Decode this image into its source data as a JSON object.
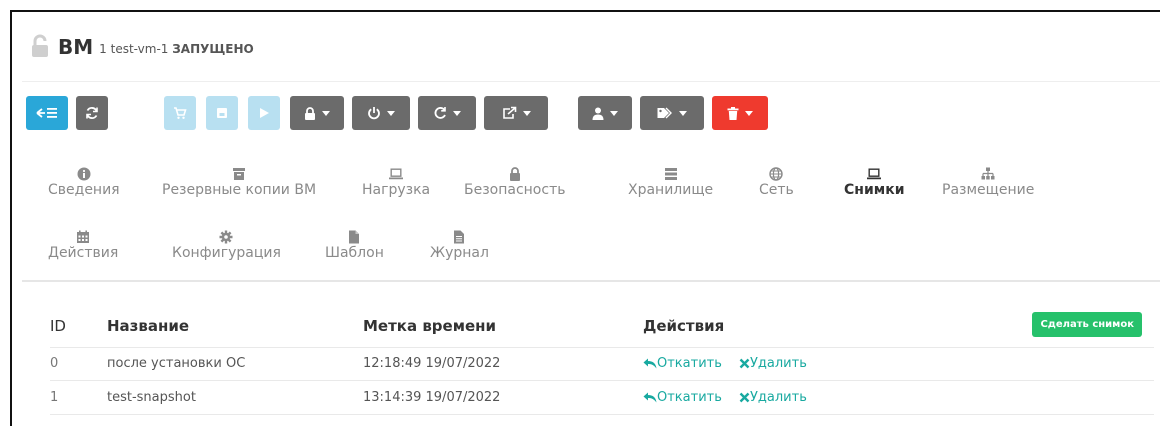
{
  "header": {
    "title": "ВМ",
    "vm_id": "1",
    "vm_name": "test-vm-1",
    "state": "ЗАПУЩЕНО"
  },
  "toolbar": {
    "buttons": [
      {
        "name": "back-to-list",
        "icon": "arrow-left-list-icon",
        "glyph": "⇐☰"
      },
      {
        "name": "refresh",
        "icon": "refresh-icon",
        "glyph": "⟳"
      },
      {
        "name": "deploy",
        "icon": "cart-icon",
        "glyph": "🛒"
      },
      {
        "name": "save",
        "icon": "save-icon",
        "glyph": "■"
      },
      {
        "name": "play",
        "icon": "play-icon",
        "glyph": "▶"
      },
      {
        "name": "lock",
        "icon": "lock-icon",
        "glyph": "🔒"
      },
      {
        "name": "power",
        "icon": "power-icon",
        "glyph": "⏻"
      },
      {
        "name": "reboot",
        "icon": "reboot-icon",
        "glyph": "↻"
      },
      {
        "name": "migrate",
        "icon": "share-icon",
        "glyph": "⇗"
      },
      {
        "name": "user",
        "icon": "user-icon",
        "glyph": "👤"
      },
      {
        "name": "labels",
        "icon": "tags-icon",
        "glyph": "🏷"
      },
      {
        "name": "delete",
        "icon": "trash-icon",
        "glyph": "🗑"
      }
    ],
    "colors": {
      "info": "#2aa7d8",
      "gray": "#6b6b6b",
      "light": "#b8e0f1",
      "danger": "#ef3a2e"
    }
  },
  "tabs": {
    "row1": [
      {
        "label": "Сведения",
        "icon": "info-circle-icon"
      },
      {
        "label": "Резервные копии ВМ",
        "icon": "archive-icon"
      },
      {
        "label": "Нагрузка",
        "icon": "laptop-icon"
      },
      {
        "label": "Безопасность",
        "icon": "lock-icon"
      },
      {
        "label": "Хранилище",
        "icon": "database-icon"
      },
      {
        "label": "Сеть",
        "icon": "globe-icon"
      },
      {
        "label": "Снимки",
        "icon": "laptop-icon",
        "active": true
      },
      {
        "label": "Размещение",
        "icon": "sitemap-icon"
      }
    ],
    "row2": [
      {
        "label": "Действия",
        "icon": "calendar-icon"
      },
      {
        "label": "Конфигурация",
        "icon": "gear-icon"
      },
      {
        "label": "Шаблон",
        "icon": "file-icon"
      },
      {
        "label": "Журнал",
        "icon": "file-text-icon"
      }
    ]
  },
  "snapshots": {
    "create_label": "Сделать снимок",
    "columns": {
      "id": "ID",
      "name": "Название",
      "timestamp": "Метка времени",
      "actions": "Действия"
    },
    "rows": [
      {
        "id": "0",
        "name": "после установки ОС",
        "timestamp": "12:18:49 19/07/2022",
        "revert": "Откатить",
        "delete": "Удалить"
      },
      {
        "id": "1",
        "name": "test-snapshot",
        "timestamp": "13:14:39 19/07/2022",
        "revert": "Откатить",
        "delete": "Удалить"
      }
    ],
    "accent": "#18a9a0",
    "create_color": "#26c16b"
  }
}
